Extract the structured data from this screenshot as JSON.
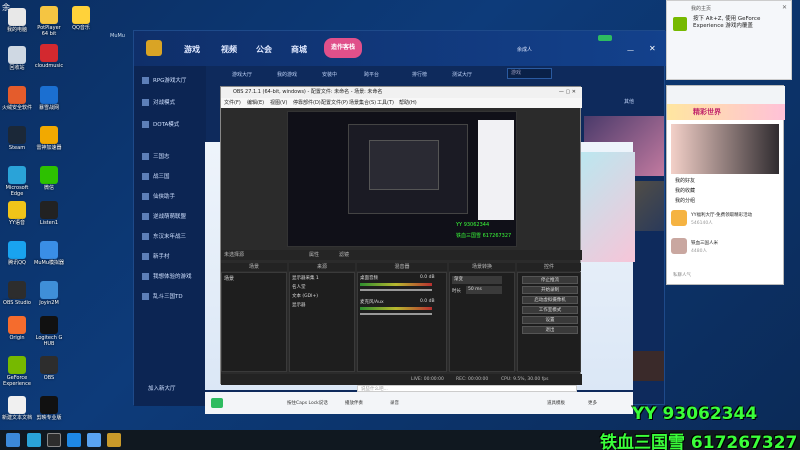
{
  "desktop": {
    "corner_label": "余",
    "icons": [
      {
        "label": "我的电脑",
        "color": "#e8e8e8"
      },
      {
        "label": "PotPlayer 64 bit",
        "color": "#f5c542"
      },
      {
        "label": "QQ音乐",
        "color": "#ffd23a"
      },
      {
        "label": "回收站",
        "color": "#cfd8e3"
      },
      {
        "label": "cloudmusic",
        "color": "#d3292f"
      },
      {
        "label": "火绒安全软件",
        "color": "#e45c2c"
      },
      {
        "label": "暴雪战网",
        "color": "#1b6fd1"
      },
      {
        "label": "Steam",
        "color": "#1b2838"
      },
      {
        "label": "雷神加速器",
        "color": "#f2a900"
      },
      {
        "label": "Microsoft Edge",
        "color": "#2aa3d8"
      },
      {
        "label": "微信",
        "color": "#2dc100"
      },
      {
        "label": "YY语音",
        "color": "#f0c419"
      },
      {
        "label": "Listen1",
        "color": "#222222"
      },
      {
        "label": "腾讯QQ",
        "color": "#19a3f0"
      },
      {
        "label": "MuMu模拟器",
        "color": "#3a8ee6"
      },
      {
        "label": "OBS Studio",
        "color": "#2d2d2d"
      },
      {
        "label": "Joyin2M",
        "color": "#3f8fd8"
      },
      {
        "label": "Origin",
        "color": "#f56c2d"
      },
      {
        "label": "Logitech G HUB",
        "color": "#111111"
      },
      {
        "label": "GeForce Experience",
        "color": "#76b900"
      },
      {
        "label": "OBS",
        "color": "#2d2d2d"
      },
      {
        "label": "新建文本文档",
        "color": "#f0f0f0"
      },
      {
        "label": "剪映专业版",
        "color": "#111111"
      }
    ]
  },
  "game_client": {
    "window_title": "MuMu",
    "nav": [
      "游戏",
      "视频",
      "公会",
      "商城"
    ],
    "event_badge": "造作客栈",
    "user": "余成人",
    "search_placeholder": "游戏",
    "subtabs": [
      "游戏大厅",
      "我的游戏",
      "安装中",
      "跨平台",
      "排行榜",
      "测试大厅",
      "其他"
    ],
    "side_items": [
      "RPG游戏大厅",
      "对战模式",
      "DOTA模式",
      "三国志",
      "战三国",
      "仙侠助手",
      "逆战萌萌联盟",
      "东汉末年战三",
      "新手村",
      "我想体验的游戏",
      "乱斗三国TD"
    ],
    "side_footer": "加入新大厅"
  },
  "obs": {
    "title": "OBS 27.1.1 (64-bit, windows) - 配置文件: 未命名 - 场景: 未命名",
    "menu": [
      "文件(F)",
      "编辑(E)",
      "视图(V)",
      "停靠部件(D)",
      "配置文件(P)",
      "场景集合(S)",
      "工具(T)",
      "帮助(H)"
    ],
    "preview_overlay_line1": "YY 93062344",
    "preview_overlay_line2": "铁血三国雪 617267327",
    "scene_bar_label": "未选择源",
    "scene_bar_props": "属性",
    "scene_bar_filters": "滤镜",
    "docks": [
      "场景",
      "来源",
      "混音器",
      "场景转换",
      "控件"
    ],
    "scenes": [
      "场景"
    ],
    "sources": [
      "显示器采集 1",
      "名人堂",
      "文本 (GDI+)",
      "显示器"
    ],
    "mixer": [
      {
        "name": "桌面音频",
        "level": "0.0 dB"
      },
      {
        "name": "麦克风/Aux",
        "level": "0.0 dB"
      }
    ],
    "transition": {
      "type": "渐变",
      "duration_label": "时长",
      "duration": "50 ms"
    },
    "controls": [
      "停止推流",
      "开始录制",
      "启动虚拟摄像机",
      "工作室模式",
      "设置",
      "退出"
    ],
    "status": {
      "live": "LIVE: 00:00:00",
      "rec": "REC: 00:00:00",
      "cpu": "CPU: 9.5%, 30.00 fps"
    }
  },
  "geforce_popup": {
    "title": "我的主页",
    "message": "按下 Alt+Z, 使用 GeForce Experience 游戏内覆盖"
  },
  "chat_app": {
    "banner": "精彩世界",
    "sections": [
      "我的好友",
      "我的收藏",
      "我的分组"
    ],
    "entries": [
      {
        "name": "YY福利大厅-免费领取精彩活动",
        "sub": "546140人"
      },
      {
        "name": "铁血三国人米",
        "sub": "4480人"
      }
    ],
    "input_placeholder": "私聊人气"
  },
  "bottom_bar": {
    "input_placeholder": "说些什么吧...",
    "items": [
      "按住Caps Lock说话",
      "播放伴奏",
      "录音",
      "道具模板",
      "更多"
    ]
  },
  "watermark": {
    "line1": "YY 93062344",
    "line2": "铁血三国雪 617267327"
  },
  "colors": {
    "watermark": "#3aff3a",
    "game_bg": "#0e2a5c",
    "obs_bg": "#2b2b2b"
  }
}
